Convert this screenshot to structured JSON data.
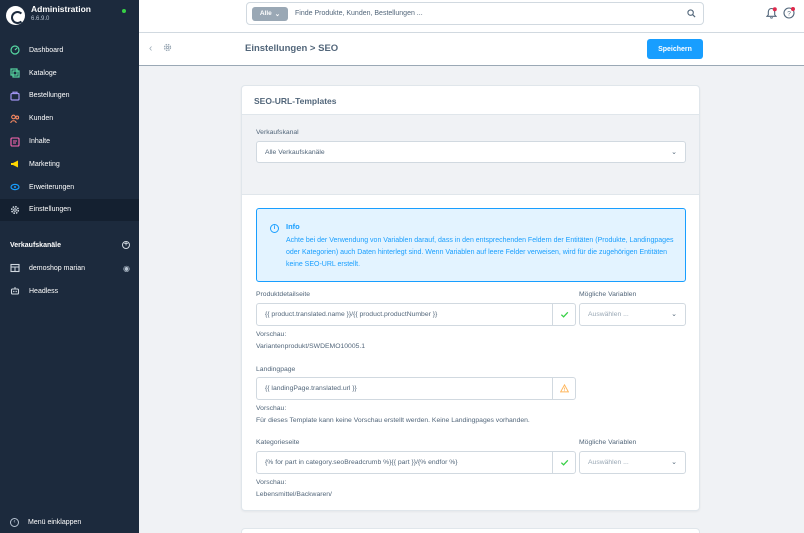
{
  "brand": {
    "title": "Administration",
    "version": "6.6.9.0",
    "status_color": "#37d046"
  },
  "nav": [
    {
      "label": "Dashboard",
      "icon": "dashboard-icon",
      "color": "#57d9a3"
    },
    {
      "label": "Kataloge",
      "icon": "catalogue-icon",
      "color": "#57d9a3"
    },
    {
      "label": "Bestellungen",
      "icon": "orders-icon",
      "color": "#a092f0"
    },
    {
      "label": "Kunden",
      "icon": "customers-icon",
      "color": "#f88962"
    },
    {
      "label": "Inhalte",
      "icon": "content-icon",
      "color": "#ff68b4"
    },
    {
      "label": "Marketing",
      "icon": "marketing-icon",
      "color": "#ffd700"
    },
    {
      "label": "Erweiterungen",
      "icon": "extensions-icon",
      "color": "#189eff"
    },
    {
      "label": "Einstellungen",
      "icon": "settings-icon",
      "color": "#9aa8b5"
    }
  ],
  "sales_channels": {
    "heading": "Verkaufskanäle",
    "items": [
      {
        "label": "demoshop marian",
        "icon": "storefront-icon"
      },
      {
        "label": "Headless",
        "icon": "headless-icon"
      }
    ]
  },
  "collapse_label": "Menü einklappen",
  "search": {
    "type_label": "Alle",
    "placeholder": "Finde Produkte, Kunden, Bestellungen ..."
  },
  "smartbar": {
    "title": "Einstellungen > SEO",
    "save_label": "Speichern"
  },
  "card": {
    "title": "SEO-URL-Templates",
    "sales_channel_label": "Verkaufskanal",
    "sales_channel_value": "Alle Verkaufskanäle",
    "info_title": "Info",
    "info_text": "Achte bei der Verwendung von Variablen darauf, dass in den entsprechenden Feldern der Entitäten (Produkte, Landingpages oder Kategorien) auch Daten hinterlegt sind. Wenn Variablen auf leere Felder verweisen, wird für die zugehörigen Entitäten keine SEO-URL erstellt.",
    "variables_label": "Mögliche Variablen",
    "variables_placeholder": "Auswählen ...",
    "preview_label": "Vorschau:",
    "product": {
      "label": "Produktdetailseite",
      "value": "{{ product.translated.name }}/{{ product.productNumber }}",
      "preview": "Variantenprodukt/SWDEMO10005.1"
    },
    "landing": {
      "label": "Landingpage",
      "value": "{{ landingPage.translated.url }}",
      "preview": "Für dieses Template kann keine Vorschau erstellt werden. Keine Landingpages vorhanden."
    },
    "category": {
      "label": "Kategorieseite",
      "value": "{% for part in category.seoBreadcrumb %}{{ part }}/{% endfor %}",
      "preview": "Lebensmittel/Backwaren/"
    }
  }
}
